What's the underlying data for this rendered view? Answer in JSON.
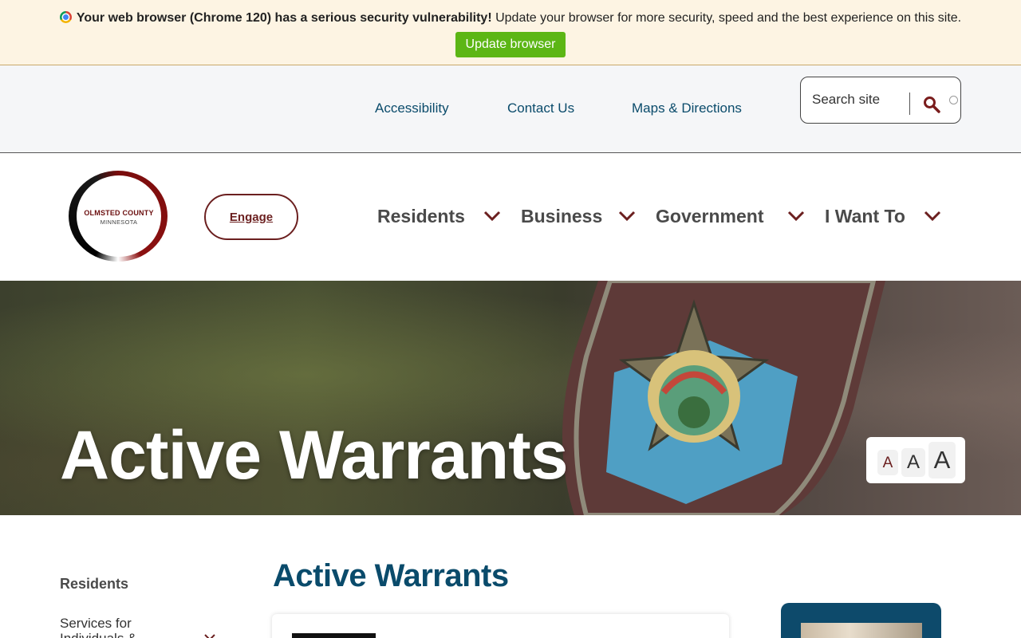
{
  "banner": {
    "bold_text": "Your web browser (Chrome 120) has a serious security vulnerability!",
    "text": " Update your browser for more security, speed and the best experience on this site.",
    "button_label": "Update browser",
    "icon": "chrome-icon",
    "button_color": "#5cb615"
  },
  "utility": {
    "links": [
      "Accessibility",
      "Contact Us",
      "Maps & Directions"
    ],
    "search_placeholder": "Search site",
    "search_icon": "search-icon"
  },
  "header": {
    "logo_title": "OLMSTED COUNTY",
    "logo_sub": "MINNESOTA",
    "engage_label": "Engage",
    "nav": [
      "Residents",
      "Business",
      "Government",
      "I Want To"
    ],
    "accent_color": "#6b1f1f",
    "link_color": "#0a4b6b"
  },
  "hero": {
    "title": "Active Warrants",
    "text_size": {
      "small": "A",
      "medium": "A",
      "large": "A"
    }
  },
  "content": {
    "side_nav_heading": "Residents",
    "side_nav_item": "Services for Individuals &",
    "page_heading": "Active Warrants"
  }
}
